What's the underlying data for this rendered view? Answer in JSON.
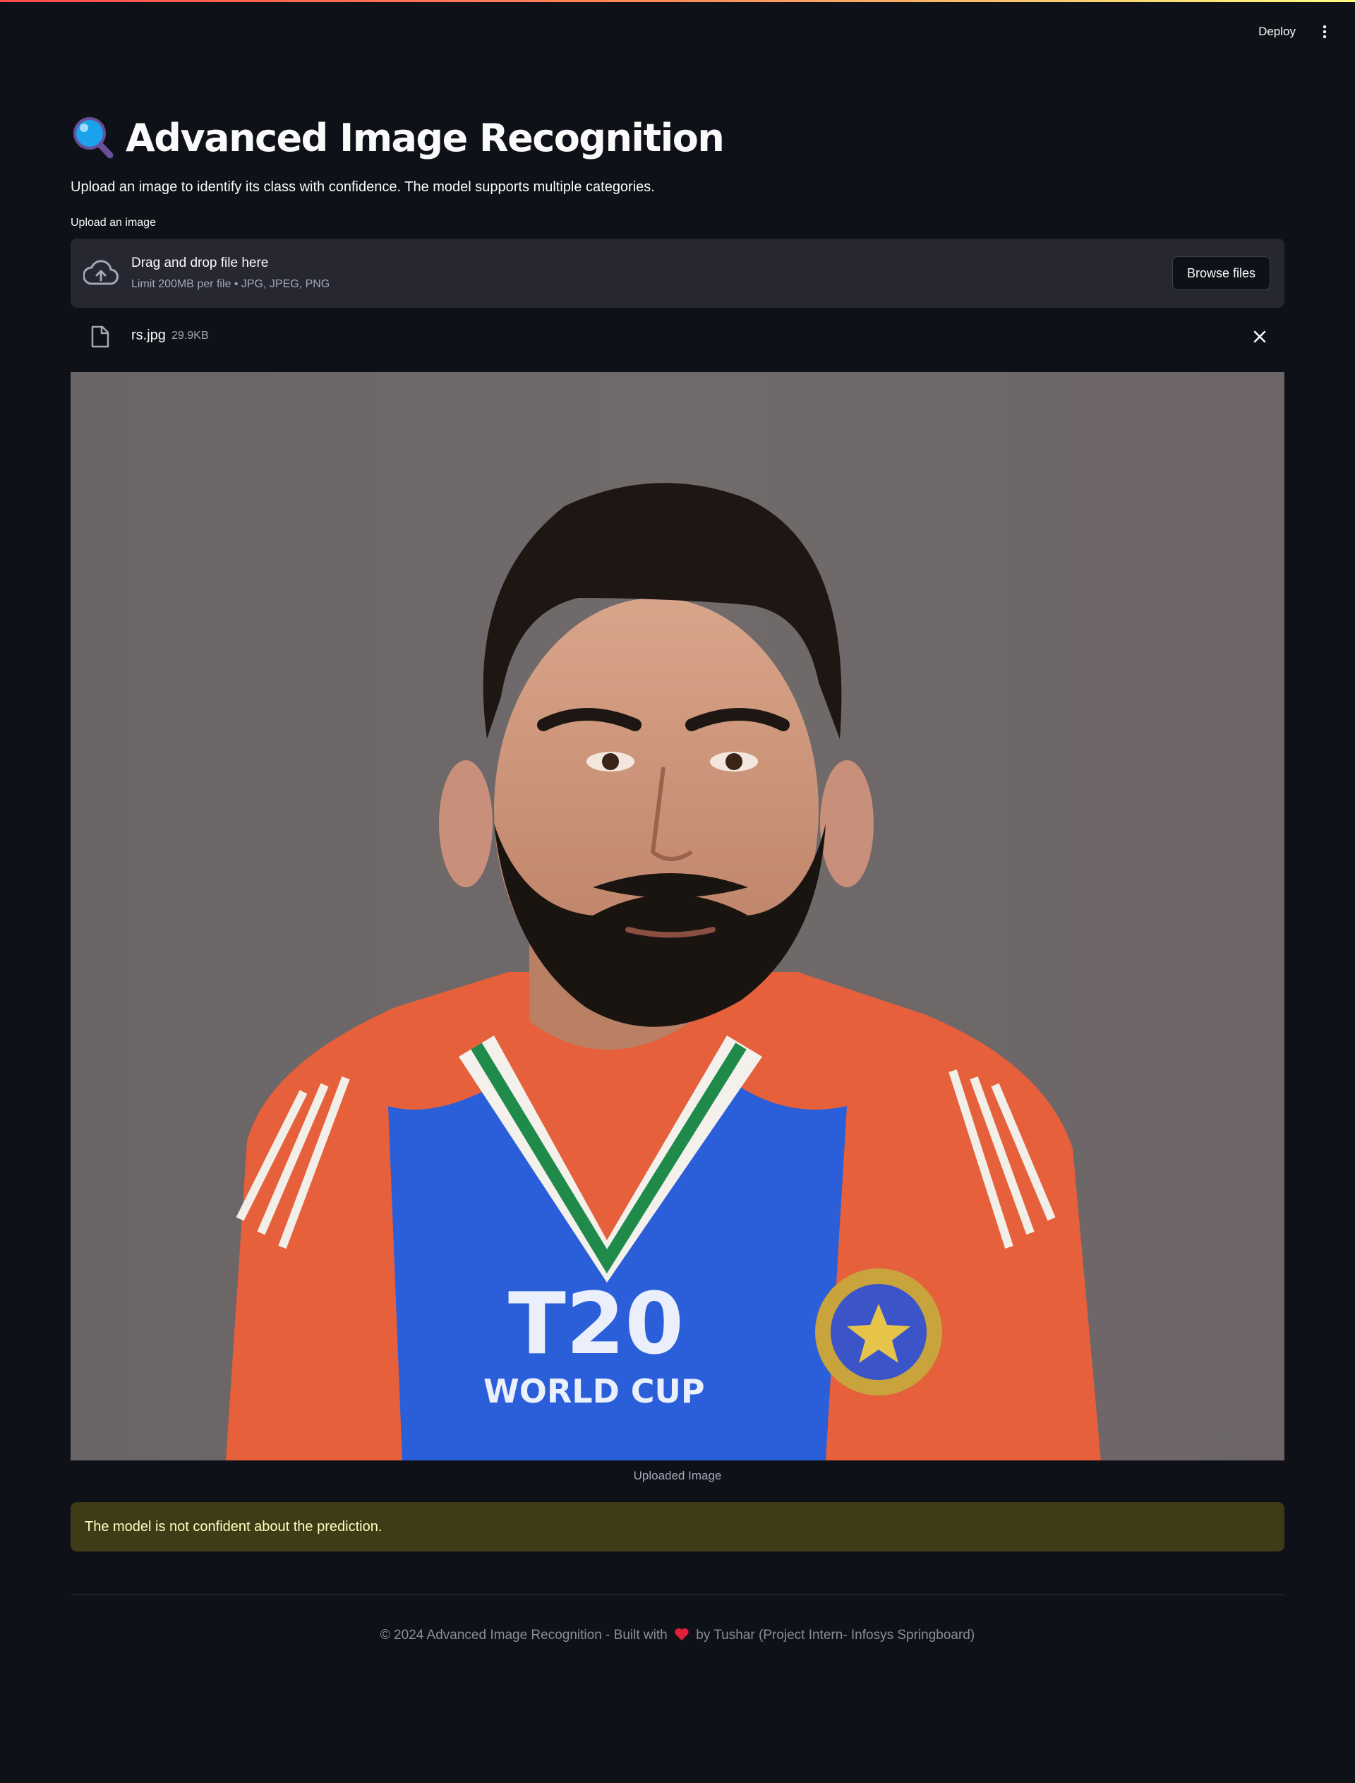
{
  "toolbar": {
    "deploy_label": "Deploy",
    "menu_icon": "kebab-menu-icon"
  },
  "header": {
    "title_icon": "magnifying-glass-icon",
    "title": "Advanced Image Recognition",
    "subtitle": "Upload an image to identify its class with confidence. The model supports multiple categories."
  },
  "uploader": {
    "label": "Upload an image",
    "drop_title": "Drag and drop file here",
    "drop_limit": "Limit 200MB per file • JPG, JPEG, PNG",
    "browse_label": "Browse files",
    "upload_icon": "cloud-upload-icon"
  },
  "file": {
    "name": "rs.jpg",
    "size": "29.9KB",
    "icon": "file-icon",
    "remove_icon": "close-icon"
  },
  "image": {
    "caption": "Uploaded Image"
  },
  "alert": {
    "message": "The model is not confident about the prediction."
  },
  "footer": {
    "text_before": "© 2024 Advanced Image Recognition - Built with",
    "text_after": "by Tushar (Project Intern- Infosys Springboard)",
    "heart_icon": "heart-icon"
  },
  "colors": {
    "background": "#0e1117",
    "dropzone": "#262730",
    "warning_bg": "#3e3b16",
    "warning_text": "#ffffc2"
  }
}
